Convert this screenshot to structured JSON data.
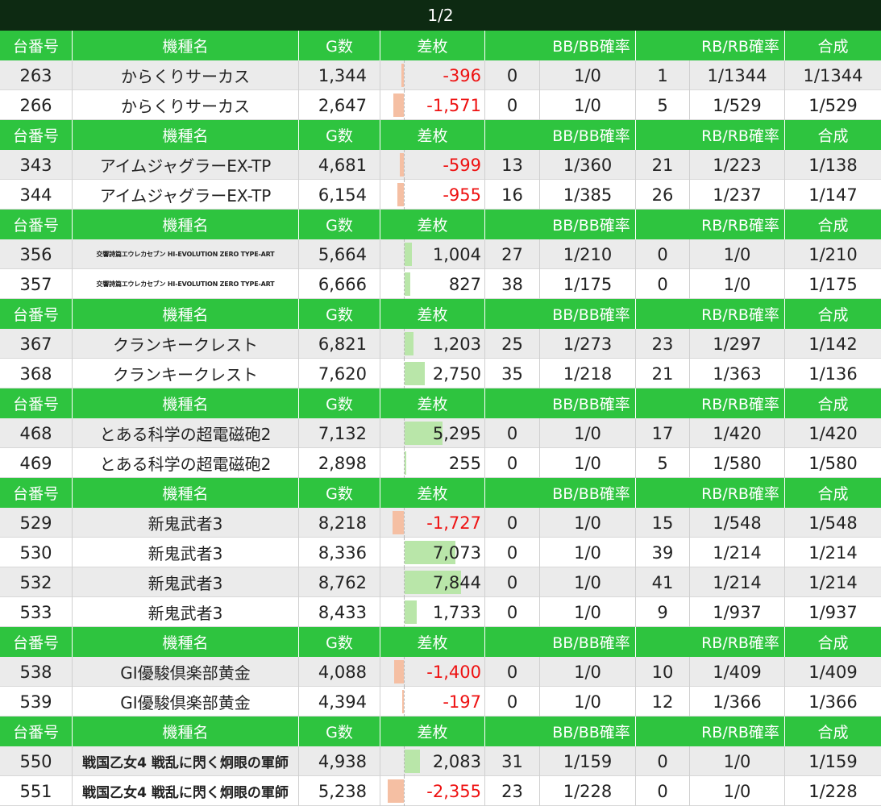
{
  "page_indicator": "1/2",
  "headers": {
    "no": "台番号",
    "name": "機種名",
    "games": "G数",
    "diff": "差枚",
    "bb": "BB/BB確率",
    "rb": "RB/RB確率",
    "total": "合成"
  },
  "colors": {
    "banner": "#0d2a12",
    "header": "#2ec43f",
    "positive_bar": "#b9e6a9",
    "negative_bar": "#f5bfa3",
    "negative_text": "#ee1111"
  },
  "groups": [
    {
      "rows": [
        {
          "no": "263",
          "name": "からくりサーカス",
          "games": "1,344",
          "diff": "-396",
          "diff_value": -396,
          "bb": "0",
          "bb_rate": "1/0",
          "rb": "1",
          "rb_rate": "1/1344",
          "total": "1/1344"
        },
        {
          "no": "266",
          "name": "からくりサーカス",
          "games": "2,647",
          "diff": "-1,571",
          "diff_value": -1571,
          "bb": "0",
          "bb_rate": "1/0",
          "rb": "5",
          "rb_rate": "1/529",
          "total": "1/529"
        }
      ]
    },
    {
      "rows": [
        {
          "no": "343",
          "name": "アイムジャグラーEX-TP",
          "games": "4,681",
          "diff": "-599",
          "diff_value": -599,
          "bb": "13",
          "bb_rate": "1/360",
          "rb": "21",
          "rb_rate": "1/223",
          "total": "1/138"
        },
        {
          "no": "344",
          "name": "アイムジャグラーEX-TP",
          "games": "6,154",
          "diff": "-955",
          "diff_value": -955,
          "bb": "16",
          "bb_rate": "1/385",
          "rb": "26",
          "rb_rate": "1/237",
          "total": "1/147"
        }
      ]
    },
    {
      "rows": [
        {
          "no": "356",
          "name": "交響詩篇エウレカセブン HI-EVOLUTION ZERO TYPE-ART",
          "name_style": "tiny",
          "games": "5,664",
          "diff": "1,004",
          "diff_value": 1004,
          "bb": "27",
          "bb_rate": "1/210",
          "rb": "0",
          "rb_rate": "1/0",
          "total": "1/210"
        },
        {
          "no": "357",
          "name": "交響詩篇エウレカセブン HI-EVOLUTION ZERO TYPE-ART",
          "name_style": "tiny",
          "games": "6,666",
          "diff": "827",
          "diff_value": 827,
          "bb": "38",
          "bb_rate": "1/175",
          "rb": "0",
          "rb_rate": "1/0",
          "total": "1/175"
        }
      ]
    },
    {
      "rows": [
        {
          "no": "367",
          "name": "クランキークレスト",
          "games": "6,821",
          "diff": "1,203",
          "diff_value": 1203,
          "bb": "25",
          "bb_rate": "1/273",
          "rb": "23",
          "rb_rate": "1/297",
          "total": "1/142"
        },
        {
          "no": "368",
          "name": "クランキークレスト",
          "games": "7,620",
          "diff": "2,750",
          "diff_value": 2750,
          "bb": "35",
          "bb_rate": "1/218",
          "rb": "21",
          "rb_rate": "1/363",
          "total": "1/136"
        }
      ]
    },
    {
      "rows": [
        {
          "no": "468",
          "name": "とある科学の超電磁砲2",
          "games": "7,132",
          "diff": "5,295",
          "diff_value": 5295,
          "bb": "0",
          "bb_rate": "1/0",
          "rb": "17",
          "rb_rate": "1/420",
          "total": "1/420"
        },
        {
          "no": "469",
          "name": "とある科学の超電磁砲2",
          "games": "2,898",
          "diff": "255",
          "diff_value": 255,
          "bb": "0",
          "bb_rate": "1/0",
          "rb": "5",
          "rb_rate": "1/580",
          "total": "1/580"
        }
      ]
    },
    {
      "rows": [
        {
          "no": "529",
          "name": "新鬼武者3",
          "games": "8,218",
          "diff": "-1,727",
          "diff_value": -1727,
          "bb": "0",
          "bb_rate": "1/0",
          "rb": "15",
          "rb_rate": "1/548",
          "total": "1/548"
        },
        {
          "no": "530",
          "name": "新鬼武者3",
          "games": "8,336",
          "diff": "7,073",
          "diff_value": 7073,
          "bb": "0",
          "bb_rate": "1/0",
          "rb": "39",
          "rb_rate": "1/214",
          "total": "1/214"
        },
        {
          "no": "532",
          "name": "新鬼武者3",
          "games": "8,762",
          "diff": "7,844",
          "diff_value": 7844,
          "bb": "0",
          "bb_rate": "1/0",
          "rb": "41",
          "rb_rate": "1/214",
          "total": "1/214"
        },
        {
          "no": "533",
          "name": "新鬼武者3",
          "games": "8,433",
          "diff": "1,733",
          "diff_value": 1733,
          "bb": "0",
          "bb_rate": "1/0",
          "rb": "9",
          "rb_rate": "1/937",
          "total": "1/937"
        }
      ]
    },
    {
      "rows": [
        {
          "no": "538",
          "name": "GI優駿倶楽部黄金",
          "games": "4,088",
          "diff": "-1,400",
          "diff_value": -1400,
          "bb": "0",
          "bb_rate": "1/0",
          "rb": "10",
          "rb_rate": "1/409",
          "total": "1/409"
        },
        {
          "no": "539",
          "name": "GI優駿倶楽部黄金",
          "games": "4,394",
          "diff": "-197",
          "diff_value": -197,
          "bb": "0",
          "bb_rate": "1/0",
          "rb": "12",
          "rb_rate": "1/366",
          "total": "1/366"
        }
      ]
    },
    {
      "rows": [
        {
          "no": "550",
          "name": "戦国乙女4 戦乱に閃く炯眼の軍師",
          "name_style": "small",
          "games": "4,938",
          "diff": "2,083",
          "diff_value": 2083,
          "bb": "31",
          "bb_rate": "1/159",
          "rb": "0",
          "rb_rate": "1/0",
          "total": "1/159"
        },
        {
          "no": "551",
          "name": "戦国乙女4 戦乱に閃く炯眼の軍師",
          "name_style": "small",
          "games": "5,238",
          "diff": "-2,355",
          "diff_value": -2355,
          "bb": "23",
          "bb_rate": "1/228",
          "rb": "0",
          "rb_rate": "1/0",
          "total": "1/228"
        }
      ]
    }
  ]
}
